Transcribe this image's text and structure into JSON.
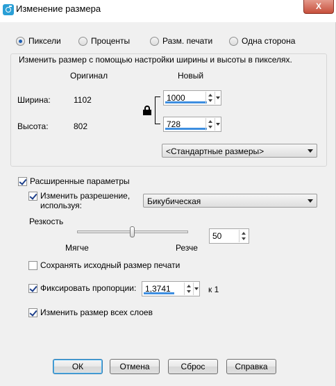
{
  "window": {
    "title": "Изменение размера",
    "close_label": "X"
  },
  "mode_radios": [
    {
      "label": "Пиксели",
      "checked": true
    },
    {
      "label": "Проценты",
      "checked": false
    },
    {
      "label": "Разм. печати",
      "checked": false
    },
    {
      "label": "Одна сторона",
      "checked": false
    }
  ],
  "pixels_group": {
    "caption": "Изменить размер с помощью настройки ширины и высоты в пикселях.",
    "col_original": "Оригинал",
    "col_new": "Новый",
    "width_label": "Ширина:",
    "height_label": "Высота:",
    "width_original": "1102",
    "height_original": "802",
    "width_new": "1000",
    "height_new": "728",
    "preset_combo": "<Стандартные размеры>"
  },
  "advanced": {
    "label": "Расширенные параметры",
    "checked": true,
    "resample": {
      "label": "Изменить разрешение, используя:",
      "label_line1": "Изменить разрешение,",
      "label_line2": "используя:",
      "checked": true,
      "method": "Бикубическая"
    },
    "sharpness": {
      "label": "Резкость",
      "min_label": "Мягче",
      "max_label": "Резче",
      "value": "50",
      "level": 50
    },
    "keep_print_size": {
      "label": "Сохранять исходный размер печати",
      "checked": false
    },
    "lock_aspect": {
      "label": "Фиксировать пропорции:",
      "checked": true,
      "ratio": "1,3741",
      "suffix": "к 1"
    },
    "resize_all_layers": {
      "label": "Изменить размер всех слоев",
      "checked": true
    }
  },
  "buttons": {
    "ok": "ОК",
    "cancel": "Отмена",
    "reset": "Сброс",
    "help": "Справка"
  }
}
